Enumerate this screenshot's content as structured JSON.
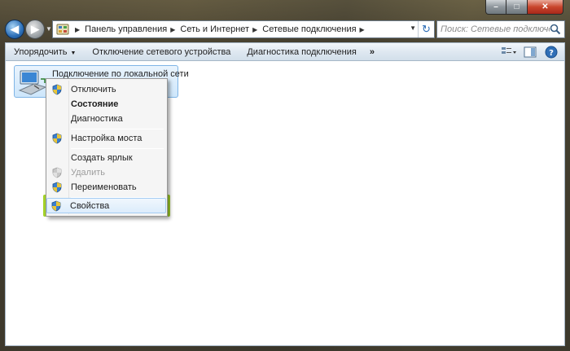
{
  "window": {
    "caption_min": "–",
    "caption_max": "□",
    "caption_close": "✕"
  },
  "address": {
    "breadcrumbs": [
      "Панель управления",
      "Сеть и Интернет",
      "Сетевые подключения"
    ],
    "search_placeholder": "Поиск: Сетевые подключения"
  },
  "toolbar": {
    "organize": "Упорядочить",
    "disable_device": "Отключение сетевого устройства",
    "diagnose": "Диагностика подключения",
    "more": "»"
  },
  "connection": {
    "name": "Подключение по локальной сети"
  },
  "context_menu": {
    "items": [
      {
        "label": "Отключить",
        "icon": "shield-icon"
      },
      {
        "label": "Состояние",
        "icon": ""
      },
      {
        "label": "Диагностика",
        "icon": ""
      },
      {
        "label": "Настройка моста",
        "icon": "shield-icon"
      },
      {
        "label": "Создать ярлык",
        "icon": ""
      },
      {
        "label": "Удалить",
        "icon": "shield-icon"
      },
      {
        "label": "Переименовать",
        "icon": "shield-icon"
      },
      {
        "label": "Свойства",
        "icon": "shield-icon"
      }
    ]
  },
  "colors": {
    "highlight": "#a4d32a",
    "selection": "#cde6fb"
  }
}
